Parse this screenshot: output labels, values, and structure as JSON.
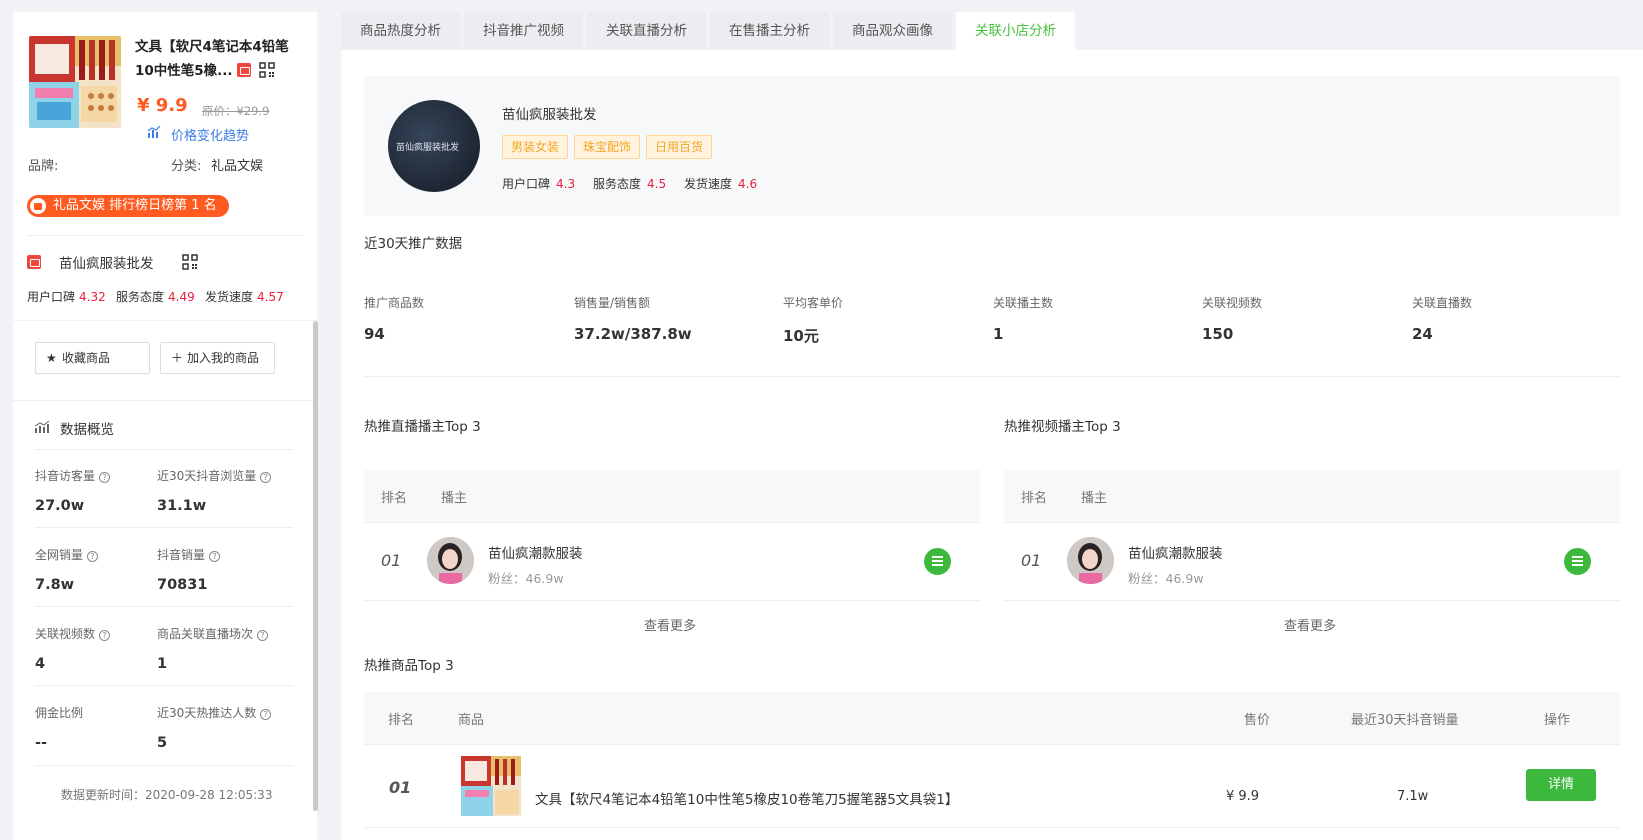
{
  "product": {
    "title": "文具【软尺4笔记本4铅笔10中性笔5橡...",
    "price": "¥ 9.9",
    "original_price": "原价：¥29.9",
    "price_trend_label": "价格变化趋势",
    "brand_label": "品牌:",
    "category_label": "分类:",
    "category_value": "礼品文娱",
    "rank_badge": "礼品文娱 排行榜日榜第 1 名"
  },
  "shop_summary": {
    "name": "苗仙疯服装批发",
    "scores": [
      {
        "label": "用户口碑",
        "value": "4.32"
      },
      {
        "label": "服务态度",
        "value": "4.49"
      },
      {
        "label": "发货速度",
        "value": "4.57"
      }
    ]
  },
  "actions": {
    "favorite": "收藏商品",
    "add_mine": "加入我的商品"
  },
  "overview": {
    "title": "数据概览",
    "stats": [
      {
        "label": "抖音访客量",
        "value": "27.0w"
      },
      {
        "label": "近30天抖音浏览量",
        "value": "31.1w"
      },
      {
        "label": "全网销量",
        "value": "7.8w"
      },
      {
        "label": "抖音销量",
        "value": "70831"
      },
      {
        "label": "关联视频数",
        "value": "4"
      },
      {
        "label": "商品关联直播场次",
        "value": "1"
      },
      {
        "label": "佣金比例",
        "value": "--"
      },
      {
        "label": "近30天热推达人数",
        "value": "5"
      }
    ],
    "updated": "数据更新时间：2020-09-28 12:05:33"
  },
  "tabs": [
    "商品热度分析",
    "抖音推广视频",
    "关联直播分析",
    "在售播主分析",
    "商品观众画像",
    "关联小店分析"
  ],
  "active_tab": 5,
  "shop": {
    "name": "苗仙疯服装批发",
    "tags": [
      "男装女装",
      "珠宝配饰",
      "日用百货"
    ],
    "scores": [
      {
        "label": "用户口碑",
        "value": "4.3"
      },
      {
        "label": "服务态度",
        "value": "4.5"
      },
      {
        "label": "发货速度",
        "value": "4.6"
      }
    ]
  },
  "promo": {
    "title": "近30天推广数据",
    "metrics": [
      {
        "label": "推广商品数",
        "value": "94"
      },
      {
        "label": "销售量/销售额",
        "value": "37.2w/387.8w"
      },
      {
        "label": "平均客单价",
        "value": "10元"
      },
      {
        "label": "关联播主数",
        "value": "1"
      },
      {
        "label": "关联视频数",
        "value": "150"
      },
      {
        "label": "关联直播数",
        "value": "24"
      }
    ]
  },
  "live_top": {
    "title": "热推直播播主Top 3",
    "col_rank": "排名",
    "col_anchor": "播主",
    "rows": [
      {
        "rank": "01",
        "name": "苗仙疯潮款服装",
        "fans": "粉丝：46.9w"
      }
    ],
    "more": "查看更多"
  },
  "video_top": {
    "title": "热推视频播主Top 3",
    "col_rank": "排名",
    "col_anchor": "播主",
    "rows": [
      {
        "rank": "01",
        "name": "苗仙疯潮款服装",
        "fans": "粉丝：46.9w"
      }
    ],
    "more": "查看更多"
  },
  "product_top": {
    "title": "热推商品Top 3",
    "cols": [
      "排名",
      "商品",
      "售价",
      "最近30天抖音销量",
      "操作"
    ],
    "rows": [
      {
        "rank": "01",
        "name": "文具【软尺4笔记本4铅笔10中性笔5橡皮10卷笔刀5握笔器5文具袋1】",
        "price": "¥ 9.9",
        "sales": "7.1w",
        "action": "详情"
      }
    ]
  },
  "colors": {
    "accent": "#45c23c",
    "price": "#ff5a1f",
    "score": "#e8203a",
    "tag": "#f5a623"
  }
}
